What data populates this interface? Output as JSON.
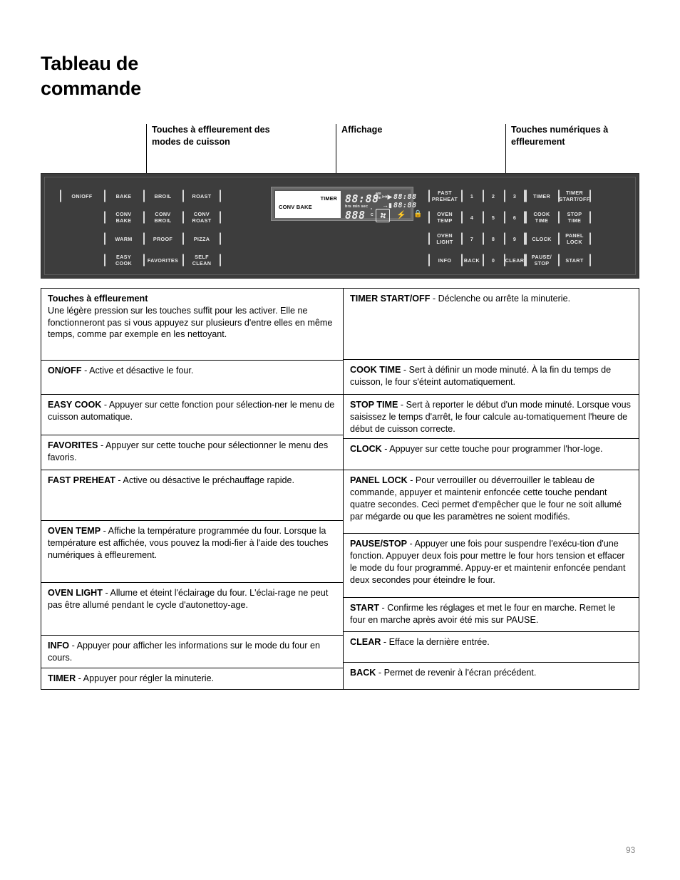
{
  "page": {
    "title_line1": "Tableau de",
    "title_line2": "commande",
    "number": "93"
  },
  "callouts": {
    "cooking_modes": "Touches à effleurement\ndes modes de cuisson",
    "display": "Affichage",
    "numeric_keys": "Touches numériques à\neffleurement"
  },
  "control_panel": {
    "left_keys": [
      "ON/OFF",
      "BAKE",
      "BROIL",
      "ROAST",
      "",
      "CONV\nBAKE",
      "CONV\nBROIL",
      "CONV\nROAST",
      "",
      "WARM",
      "PROOF",
      "PIZZA",
      "",
      "EASY\nCOOK",
      "FAVORITES",
      "SELF\nCLEAN"
    ],
    "right_keys": [
      "FAST\nPREHEAT",
      "1",
      "2",
      "3",
      "TIMER",
      "TIMER\nSTART/OFF",
      "OVEN\nTEMP",
      "4",
      "5",
      "6",
      "COOK\nTIME",
      "STOP\nTIME",
      "OVEN\nLIGHT",
      "7",
      "8",
      "9",
      "CLOCK",
      "PANEL\nLOCK",
      "INFO",
      "BACK",
      "0",
      "CLEAR",
      "PAUSE/\nSTOP",
      "START"
    ],
    "display": {
      "mode_text": "CONV BAKE",
      "timer_label": "TIMER",
      "clock_value": "88:88",
      "ampm": "am\npm",
      "units": "hrs min sec",
      "temp_value": "888",
      "degree_units": "°\nC",
      "cook_start_value": "88:88",
      "stop_end_value": "88:88",
      "icons": {
        "cook_start": "cook-start-arrow-icon",
        "stop_end": "stop-end-arrow-icon",
        "convection_fan": "convection-fan-icon",
        "broil_element": "broil-bolt-icon",
        "panel_lock": "lock-icon"
      }
    }
  },
  "table": {
    "left_rows": [
      {
        "title": "Touches à effleurement",
        "body": "Une légère pression sur les touches suffit pour les activer. Elle ne fonctionneront pas si vous appuyez sur plusieurs d'entre elles en même temps, comme par exemple en les nettoyant.",
        "title_block": true
      },
      {
        "title": "ON/OFF",
        "body": " - Active et désactive le four."
      },
      {
        "title": "EASY COOK",
        "body": " - Appuyer sur cette fonction pour sélection-ner le menu de cuisson automatique."
      },
      {
        "title": "FAVORITES",
        "body": " - Appuyer sur cette touche pour sélectionner le menu des favoris."
      },
      {
        "title": "FAST PREHEAT",
        "body": " - Active ou désactive le préchauffage rapide."
      },
      {
        "title": "OVEN TEMP",
        "body": " - Affiche la température programmée du four. Lorsque la température est affichée, vous pouvez la modi-fier à l'aide des touches numériques à effleurement."
      },
      {
        "title": "OVEN LIGHT",
        "body": " - Allume et éteint l'éclairage du four. L'éclai-rage ne peut pas être allumé pendant le cycle d'autonettoy-age."
      },
      {
        "title": "INFO",
        "body": " - Appuyer pour afficher les informations sur le mode du four en cours."
      },
      {
        "title": "TIMER",
        "body": " - Appuyer pour régler la minuterie."
      }
    ],
    "right_rows": [
      {
        "title": "TIMER START/OFF",
        "body": " - Déclenche ou arrête la minuterie."
      },
      {
        "title": "COOK TIME",
        "body": " - Sert à définir un mode minuté. À la fin du temps de cuisson, le four s'éteint automatiquement."
      },
      {
        "title": "STOP TIME",
        "body": " - Sert à reporter le début d'un mode minuté. Lorsque vous saisissez le temps d'arrêt, le four calcule au-tomatiquement l'heure de début de cuisson correcte."
      },
      {
        "title": "CLOCK",
        "body": " - Appuyer sur cette touche pour programmer l'hor-loge."
      },
      {
        "title": "PANEL LOCK",
        "body": "  - Pour verrouiller ou déverrouiller le tableau de commande, appuyer et maintenir enfoncée cette touche pendant quatre secondes. Ceci permet d'empêcher que le four ne soit allumé par mégarde ou que les paramètres ne soient modifiés."
      },
      {
        "title": "PAUSE/STOP",
        "body": " - Appuyer une fois pour suspendre l'exécu-tion d'une fonction. Appuyer deux fois pour mettre le four hors tension et effacer le mode du four programmé. Appuy-er et maintenir enfoncée pendant deux secondes pour éteindre le four."
      },
      {
        "title": "START",
        "body": " - Confirme les réglages et met le four en marche. Remet le four en marche après avoir été mis sur PAUSE."
      },
      {
        "title": "CLEAR",
        "body": " - Efface la dernière entrée."
      },
      {
        "title": "BACK",
        "body": " - Permet de revenir à l'écran précédent."
      }
    ],
    "left_row_heights": [
      101,
      48,
      57,
      49,
      71,
      87,
      74,
      45,
      29
    ],
    "right_row_heights": [
      100,
      49,
      62,
      44,
      89,
      90,
      48,
      43,
      36
    ]
  }
}
